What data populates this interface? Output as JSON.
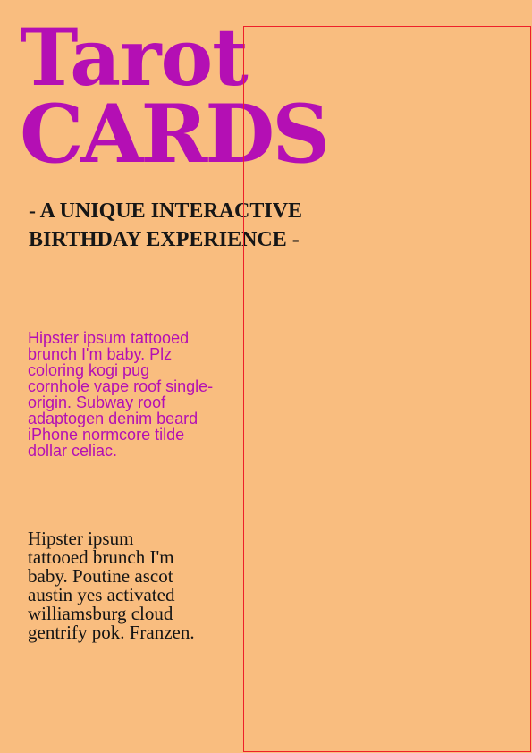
{
  "title": {
    "line1": "Tarot",
    "line2": "CARDS"
  },
  "subtitle": {
    "line1": "- A UNIQUE INTERACTIVE",
    "line2": "BIRTHDAY EXPERIENCE -"
  },
  "pink_paragraph": {
    "lines": [
      "Hipster ipsum tattooed",
      "brunch I'm baby. Plz",
      "coloring kogi pug",
      "cornhole vape roof single-",
      "origin. Subway roof",
      "adaptogen denim beard",
      "iPhone normcore tilde",
      "dollar celiac."
    ]
  },
  "black_paragraph": {
    "lines": [
      "Hipster ipsum",
      "tattooed brunch I'm",
      "baby. Poutine ascot",
      "austin yes activated",
      "williamsburg cloud",
      "gentrify pok. Franzen."
    ]
  },
  "colors": {
    "background": "#f9bd7f",
    "accent": "#b40fb4",
    "guide": "#ee1f2a",
    "text": "#161616"
  }
}
